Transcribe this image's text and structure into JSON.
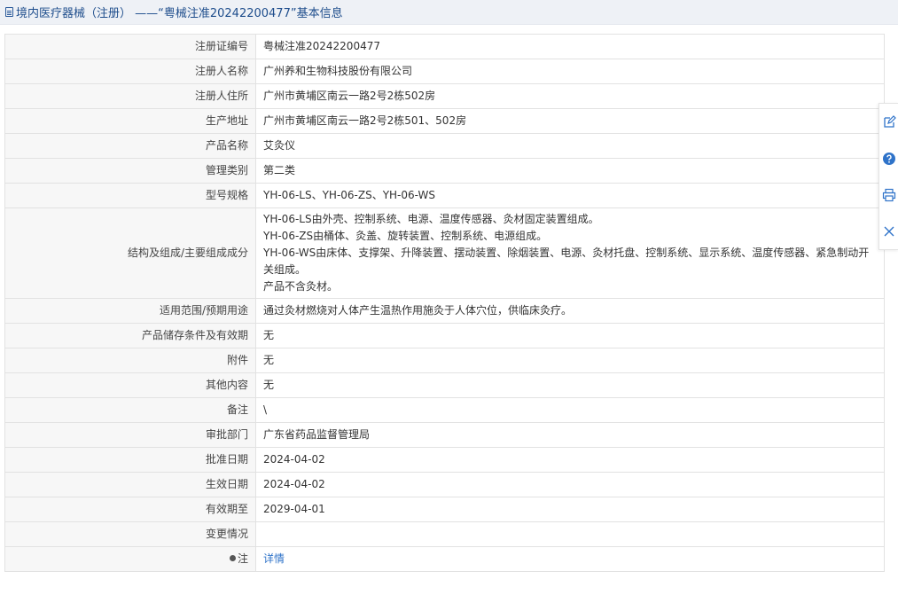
{
  "header": {
    "title": "境内医疗器械（注册） ——“粤械注准20242200477”基本信息"
  },
  "rows": [
    {
      "label": "注册证编号",
      "value": "粤械注准20242200477"
    },
    {
      "label": "注册人名称",
      "value": "广州养和生物科技股份有限公司"
    },
    {
      "label": "注册人住所",
      "value": "广州市黄埔区南云一路2号2栋502房"
    },
    {
      "label": "生产地址",
      "value": "广州市黄埔区南云一路2号2栋501、502房"
    },
    {
      "label": "产品名称",
      "value": "艾灸仪"
    },
    {
      "label": "管理类别",
      "value": "第二类"
    },
    {
      "label": "型号规格",
      "value": "YH-06-LS、YH-06-ZS、YH-06-WS"
    },
    {
      "label": "结构及组成/主要组成成分",
      "lines": [
        "YH-06-LS由外壳、控制系统、电源、温度传感器、灸材固定装置组成。",
        "YH-06-ZS由桶体、灸盖、旋转装置、控制系统、电源组成。",
        "YH-06-WS由床体、支撑架、升降装置、摆动装置、除烟装置、电源、灸材托盘、控制系统、显示系统、温度传感器、紧急制动开关组成。",
        "产品不含灸材。"
      ]
    },
    {
      "label": "适用范围/预期用途",
      "value": "通过灸材燃烧对人体产生温热作用施灸于人体穴位，供临床灸疗。"
    },
    {
      "label": "产品储存条件及有效期",
      "value": "无"
    },
    {
      "label": "附件",
      "value": "无"
    },
    {
      "label": "其他内容",
      "value": "无"
    },
    {
      "label": "备注",
      "value": "\\"
    },
    {
      "label": "审批部门",
      "value": "广东省药品监督管理局"
    },
    {
      "label": "批准日期",
      "value": "2024-04-02"
    },
    {
      "label": "生效日期",
      "value": "2024-04-02"
    },
    {
      "label": "有效期至",
      "value": "2029-04-01"
    },
    {
      "label": "变更情况",
      "value": ""
    },
    {
      "label": "注",
      "value": "详情"
    }
  ],
  "toolbar": {
    "edit_icon": "edit-icon",
    "help_icon": "help-icon",
    "print_icon": "print-icon",
    "close_icon": "close-icon",
    "accent_color": "#2f73c9"
  }
}
